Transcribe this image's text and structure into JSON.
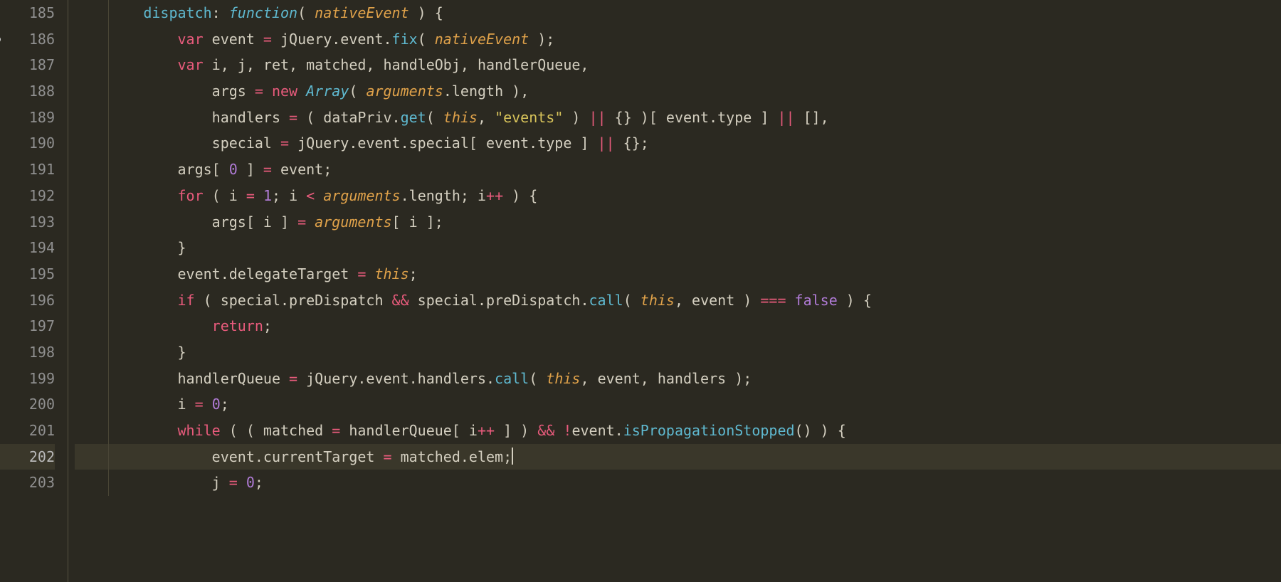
{
  "editor": {
    "modified_line": 186,
    "current_line": 202,
    "lines": [
      {
        "num": "185",
        "indent": 2,
        "tokens": [
          {
            "t": "dispatch",
            "c": "c-propkey"
          },
          {
            "t": ":",
            "c": "c-default"
          },
          {
            "t": " ",
            "c": "c-default"
          },
          {
            "t": "function",
            "c": "c-storage"
          },
          {
            "t": "( ",
            "c": "c-paren"
          },
          {
            "t": "nativeEvent",
            "c": "c-param"
          },
          {
            "t": " ) {",
            "c": "c-paren"
          }
        ]
      },
      {
        "num": "186",
        "indent": 3,
        "tokens": [
          {
            "t": "var",
            "c": "c-keyword"
          },
          {
            "t": " event ",
            "c": "c-default"
          },
          {
            "t": "=",
            "c": "c-op"
          },
          {
            "t": " jQuery.event.",
            "c": "c-default"
          },
          {
            "t": "fix",
            "c": "c-method"
          },
          {
            "t": "( ",
            "c": "c-paren"
          },
          {
            "t": "nativeEvent",
            "c": "c-param"
          },
          {
            "t": " );",
            "c": "c-paren"
          }
        ]
      },
      {
        "num": "187",
        "indent": 3,
        "tokens": [
          {
            "t": "var",
            "c": "c-keyword"
          },
          {
            "t": " i, j, ret, matched, handleObj, handlerQueue,",
            "c": "c-default"
          }
        ]
      },
      {
        "num": "188",
        "indent": 4,
        "tokens": [
          {
            "t": "args ",
            "c": "c-default"
          },
          {
            "t": "=",
            "c": "c-op"
          },
          {
            "t": " ",
            "c": "c-default"
          },
          {
            "t": "new",
            "c": "c-keyword"
          },
          {
            "t": " ",
            "c": "c-default"
          },
          {
            "t": "Array",
            "c": "c-type"
          },
          {
            "t": "( ",
            "c": "c-paren"
          },
          {
            "t": "arguments",
            "c": "c-param"
          },
          {
            "t": ".length ),",
            "c": "c-default"
          }
        ]
      },
      {
        "num": "189",
        "indent": 4,
        "tokens": [
          {
            "t": "handlers ",
            "c": "c-default"
          },
          {
            "t": "=",
            "c": "c-op"
          },
          {
            "t": " ( dataPriv.",
            "c": "c-default"
          },
          {
            "t": "get",
            "c": "c-method"
          },
          {
            "t": "( ",
            "c": "c-paren"
          },
          {
            "t": "this",
            "c": "c-param"
          },
          {
            "t": ", ",
            "c": "c-default"
          },
          {
            "t": "\"events\"",
            "c": "c-string"
          },
          {
            "t": " ) ",
            "c": "c-paren"
          },
          {
            "t": "||",
            "c": "c-op"
          },
          {
            "t": " {} )[ event.type ] ",
            "c": "c-default"
          },
          {
            "t": "||",
            "c": "c-op"
          },
          {
            "t": " [],",
            "c": "c-default"
          }
        ]
      },
      {
        "num": "190",
        "indent": 4,
        "tokens": [
          {
            "t": "special ",
            "c": "c-default"
          },
          {
            "t": "=",
            "c": "c-op"
          },
          {
            "t": " jQuery.event.special[ event.type ] ",
            "c": "c-default"
          },
          {
            "t": "||",
            "c": "c-op"
          },
          {
            "t": " {};",
            "c": "c-default"
          }
        ]
      },
      {
        "num": "191",
        "indent": 3,
        "tokens": [
          {
            "t": "args[ ",
            "c": "c-default"
          },
          {
            "t": "0",
            "c": "c-number"
          },
          {
            "t": " ] ",
            "c": "c-default"
          },
          {
            "t": "=",
            "c": "c-op"
          },
          {
            "t": " event;",
            "c": "c-default"
          }
        ]
      },
      {
        "num": "192",
        "indent": 3,
        "tokens": [
          {
            "t": "for",
            "c": "c-keyword"
          },
          {
            "t": " ( i ",
            "c": "c-default"
          },
          {
            "t": "=",
            "c": "c-op"
          },
          {
            "t": " ",
            "c": "c-default"
          },
          {
            "t": "1",
            "c": "c-number"
          },
          {
            "t": "; i ",
            "c": "c-default"
          },
          {
            "t": "<",
            "c": "c-op"
          },
          {
            "t": " ",
            "c": "c-default"
          },
          {
            "t": "arguments",
            "c": "c-param"
          },
          {
            "t": ".length; i",
            "c": "c-default"
          },
          {
            "t": "++",
            "c": "c-op"
          },
          {
            "t": " ) {",
            "c": "c-default"
          }
        ]
      },
      {
        "num": "193",
        "indent": 4,
        "tokens": [
          {
            "t": "args[ i ] ",
            "c": "c-default"
          },
          {
            "t": "=",
            "c": "c-op"
          },
          {
            "t": " ",
            "c": "c-default"
          },
          {
            "t": "arguments",
            "c": "c-param"
          },
          {
            "t": "[ i ];",
            "c": "c-default"
          }
        ]
      },
      {
        "num": "194",
        "indent": 3,
        "tokens": [
          {
            "t": "}",
            "c": "c-default"
          }
        ]
      },
      {
        "num": "195",
        "indent": 3,
        "tokens": [
          {
            "t": "event.delegateTarget ",
            "c": "c-default"
          },
          {
            "t": "=",
            "c": "c-op"
          },
          {
            "t": " ",
            "c": "c-default"
          },
          {
            "t": "this",
            "c": "c-param"
          },
          {
            "t": ";",
            "c": "c-default"
          }
        ]
      },
      {
        "num": "196",
        "indent": 3,
        "tokens": [
          {
            "t": "if",
            "c": "c-keyword"
          },
          {
            "t": " ( special.preDispatch ",
            "c": "c-default"
          },
          {
            "t": "&&",
            "c": "c-op"
          },
          {
            "t": " special.preDispatch.",
            "c": "c-default"
          },
          {
            "t": "call",
            "c": "c-method"
          },
          {
            "t": "( ",
            "c": "c-paren"
          },
          {
            "t": "this",
            "c": "c-param"
          },
          {
            "t": ", event ) ",
            "c": "c-default"
          },
          {
            "t": "===",
            "c": "c-op"
          },
          {
            "t": " ",
            "c": "c-default"
          },
          {
            "t": "false",
            "c": "c-const"
          },
          {
            "t": " ) {",
            "c": "c-default"
          }
        ]
      },
      {
        "num": "197",
        "indent": 4,
        "tokens": [
          {
            "t": "return",
            "c": "c-keyword"
          },
          {
            "t": ";",
            "c": "c-default"
          }
        ]
      },
      {
        "num": "198",
        "indent": 3,
        "tokens": [
          {
            "t": "}",
            "c": "c-default"
          }
        ]
      },
      {
        "num": "199",
        "indent": 3,
        "tokens": [
          {
            "t": "handlerQueue ",
            "c": "c-default"
          },
          {
            "t": "=",
            "c": "c-op"
          },
          {
            "t": " jQuery.event.handlers.",
            "c": "c-default"
          },
          {
            "t": "call",
            "c": "c-method"
          },
          {
            "t": "( ",
            "c": "c-paren"
          },
          {
            "t": "this",
            "c": "c-param"
          },
          {
            "t": ", event, handlers );",
            "c": "c-default"
          }
        ]
      },
      {
        "num": "200",
        "indent": 3,
        "tokens": [
          {
            "t": "i ",
            "c": "c-default"
          },
          {
            "t": "=",
            "c": "c-op"
          },
          {
            "t": " ",
            "c": "c-default"
          },
          {
            "t": "0",
            "c": "c-number"
          },
          {
            "t": ";",
            "c": "c-default"
          }
        ]
      },
      {
        "num": "201",
        "indent": 3,
        "tokens": [
          {
            "t": "while",
            "c": "c-keyword"
          },
          {
            "t": " ( ( matched ",
            "c": "c-default"
          },
          {
            "t": "=",
            "c": "c-op"
          },
          {
            "t": " handlerQueue[ i",
            "c": "c-default"
          },
          {
            "t": "++",
            "c": "c-op"
          },
          {
            "t": " ] ) ",
            "c": "c-default"
          },
          {
            "t": "&&",
            "c": "c-op"
          },
          {
            "t": " ",
            "c": "c-default"
          },
          {
            "t": "!",
            "c": "c-op"
          },
          {
            "t": "event.",
            "c": "c-default"
          },
          {
            "t": "isPropagationStopped",
            "c": "c-method"
          },
          {
            "t": "() ) {",
            "c": "c-default"
          }
        ]
      },
      {
        "num": "202",
        "indent": 4,
        "tokens": [
          {
            "t": "event.currentTarget ",
            "c": "c-default"
          },
          {
            "t": "=",
            "c": "c-op"
          },
          {
            "t": " matched.elem;",
            "c": "c-default"
          }
        ],
        "cursor_after": true
      },
      {
        "num": "203",
        "indent": 4,
        "tokens": [
          {
            "t": "j ",
            "c": "c-default"
          },
          {
            "t": "=",
            "c": "c-op"
          },
          {
            "t": " ",
            "c": "c-default"
          },
          {
            "t": "0",
            "c": "c-number"
          },
          {
            "t": ";",
            "c": "c-default"
          }
        ]
      }
    ]
  }
}
